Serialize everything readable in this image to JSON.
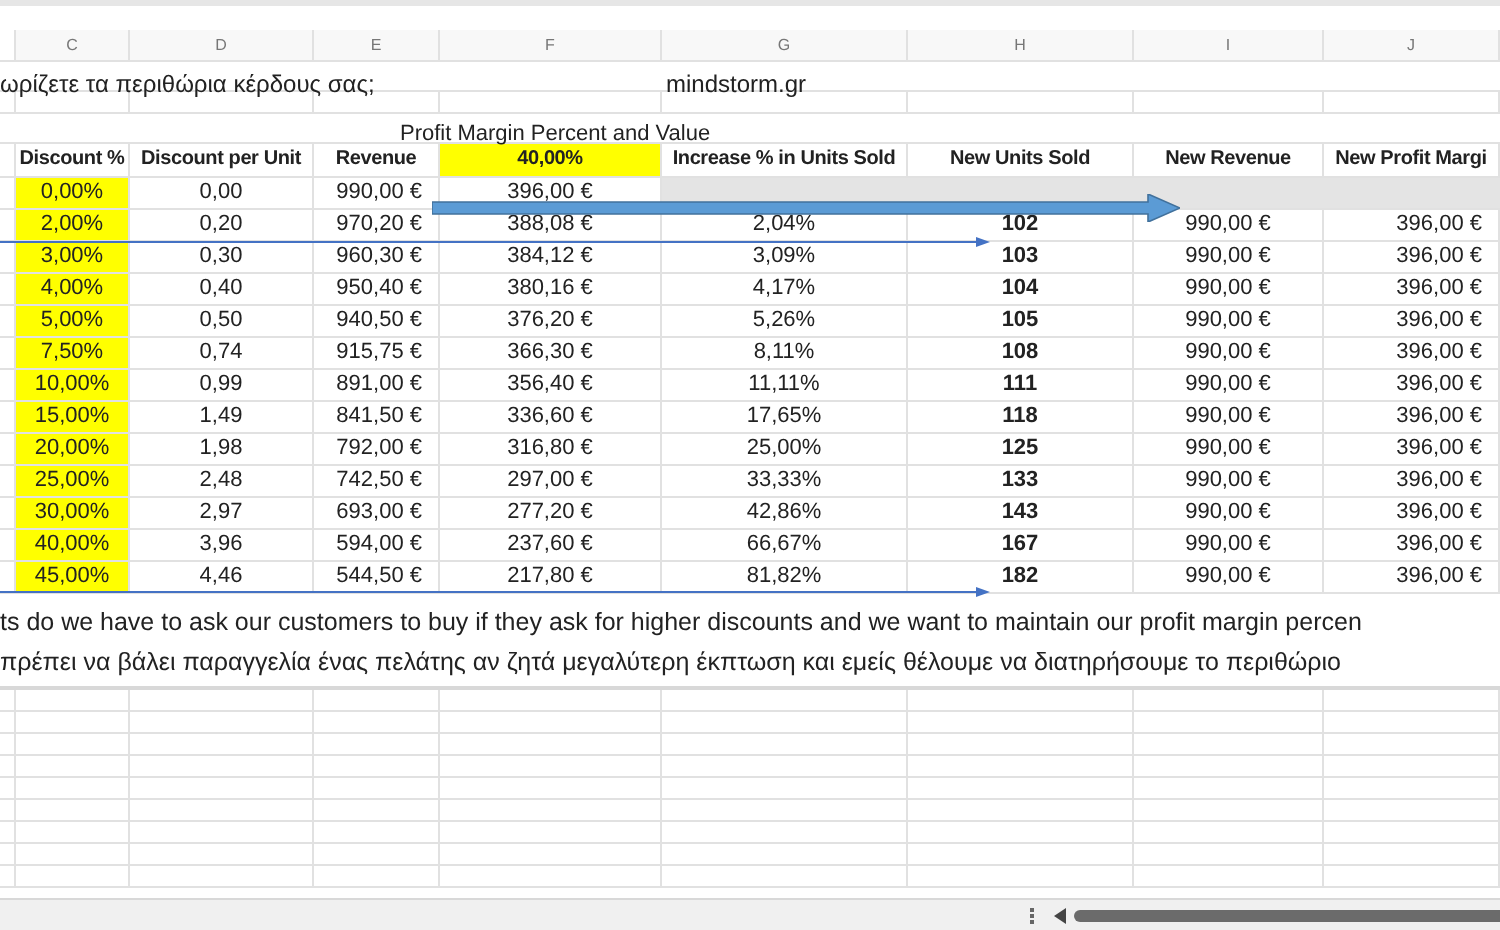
{
  "column_letters": [
    "C",
    "D",
    "E",
    "F",
    "G",
    "H",
    "I",
    "J"
  ],
  "title": "ωρίζετε τα περιθώρια κέρδους σας;",
  "site": "mindstorm.gr",
  "caption": "Profit Margin Percent and Value",
  "table": {
    "columns": [
      {
        "label": "Discount %",
        "header_highlighted": false,
        "cells_highlighted": true
      },
      {
        "label": "Discount per Unit",
        "header_highlighted": false,
        "cells_highlighted": false
      },
      {
        "label": "Revenue",
        "header_highlighted": false,
        "cells_highlighted": false
      },
      {
        "label": "40,00%",
        "header_highlighted": true,
        "cells_highlighted": false
      },
      {
        "label": "Increase % in Units Sold",
        "header_highlighted": false,
        "cells_highlighted": false
      },
      {
        "label": "New Units Sold",
        "header_highlighted": false,
        "cells_highlighted": false
      },
      {
        "label": "New Revenue",
        "header_highlighted": false,
        "cells_highlighted": false
      },
      {
        "label": "New Profit Margi",
        "header_highlighted": false,
        "cells_highlighted": false
      }
    ],
    "rows": [
      {
        "shaded": true,
        "cells": [
          "0,00%",
          "0,00",
          "990,00 €",
          "396,00 €"
        ]
      },
      {
        "shaded": false,
        "cells": [
          "2,00%",
          "0,20",
          "970,20 €",
          "388,08 €",
          "2,04%",
          "102",
          "990,00 €",
          "396,00 €"
        ]
      },
      {
        "shaded": false,
        "cells": [
          "3,00%",
          "0,30",
          "960,30 €",
          "384,12 €",
          "3,09%",
          "103",
          "990,00 €",
          "396,00 €"
        ]
      },
      {
        "shaded": false,
        "cells": [
          "4,00%",
          "0,40",
          "950,40 €",
          "380,16 €",
          "4,17%",
          "104",
          "990,00 €",
          "396,00 €"
        ]
      },
      {
        "shaded": false,
        "cells": [
          "5,00%",
          "0,50",
          "940,50 €",
          "376,20 €",
          "5,26%",
          "105",
          "990,00 €",
          "396,00 €"
        ]
      },
      {
        "shaded": false,
        "cells": [
          "7,50%",
          "0,74",
          "915,75 €",
          "366,30 €",
          "8,11%",
          "108",
          "990,00 €",
          "396,00 €"
        ]
      },
      {
        "shaded": false,
        "cells": [
          "10,00%",
          "0,99",
          "891,00 €",
          "356,40 €",
          "11,11%",
          "111",
          "990,00 €",
          "396,00 €"
        ]
      },
      {
        "shaded": false,
        "cells": [
          "15,00%",
          "1,49",
          "841,50 €",
          "336,60 €",
          "17,65%",
          "118",
          "990,00 €",
          "396,00 €"
        ]
      },
      {
        "shaded": false,
        "cells": [
          "20,00%",
          "1,98",
          "792,00 €",
          "316,80 €",
          "25,00%",
          "125",
          "990,00 €",
          "396,00 €"
        ]
      },
      {
        "shaded": false,
        "cells": [
          "25,00%",
          "2,48",
          "742,50 €",
          "297,00 €",
          "33,33%",
          "133",
          "990,00 €",
          "396,00 €"
        ]
      },
      {
        "shaded": false,
        "cells": [
          "30,00%",
          "2,97",
          "693,00 €",
          "277,20 €",
          "42,86%",
          "143",
          "990,00 €",
          "396,00 €"
        ]
      },
      {
        "shaded": false,
        "cells": [
          "40,00%",
          "3,96",
          "594,00 €",
          "237,60 €",
          "66,67%",
          "167",
          "990,00 €",
          "396,00 €"
        ]
      },
      {
        "shaded": false,
        "cells": [
          "45,00%",
          "4,46",
          "544,50 €",
          "217,80 €",
          "81,82%",
          "182",
          "990,00 €",
          "396,00 €"
        ]
      }
    ]
  },
  "notes": [
    "ts do we have to ask our customers to buy if they ask for higher discounts and we want to maintain our profit margin percen",
    "πρέπει να βάλει παραγγελία ένας πελάτης αν ζητά μεγαλύτερη έκπτωση και εμείς θέλουμε να διατηρήσουμε το περιθώριο"
  ]
}
